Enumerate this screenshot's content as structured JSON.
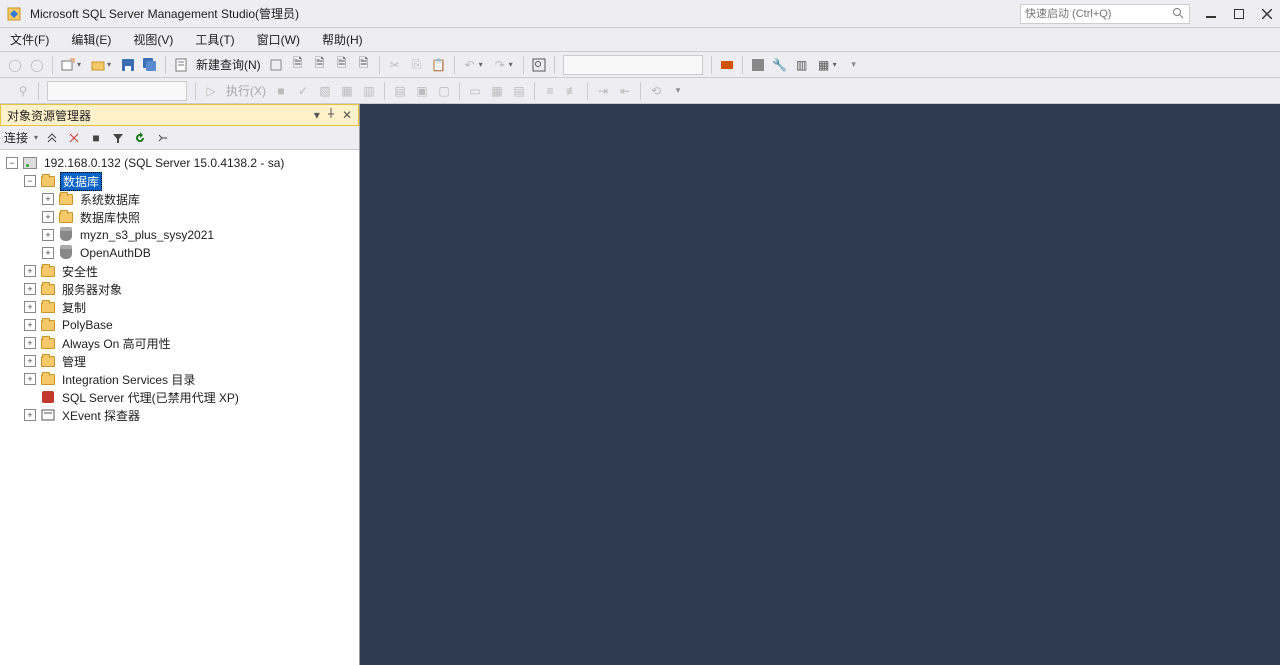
{
  "title": "Microsoft SQL Server Management Studio(管理员)",
  "quick_launch_placeholder": "快速启动 (Ctrl+Q)",
  "menus": {
    "file": "文件(F)",
    "edit": "编辑(E)",
    "view": "视图(V)",
    "tools": "工具(T)",
    "window": "窗口(W)",
    "help": "帮助(H)"
  },
  "toolbar1": {
    "new_query": "新建查询(N)"
  },
  "toolbar2": {
    "execute": "执行(X)"
  },
  "panel": {
    "title": "对象资源管理器",
    "toolbar": {
      "connect": "连接"
    }
  },
  "tree": {
    "server": "192.168.0.132 (SQL Server 15.0.4138.2 - sa)",
    "databases": "数据库",
    "sys_db": "系统数据库",
    "db_snap": "数据库快照",
    "db1": "myzn_s3_plus_sysy2021",
    "db2": "OpenAuthDB",
    "security": "安全性",
    "server_obj": "服务器对象",
    "replication": "复制",
    "polybase": "PolyBase",
    "alwayson": "Always On 高可用性",
    "management": "管理",
    "integration": "Integration Services 目录",
    "agent": "SQL Server 代理(已禁用代理 XP)",
    "xevent": "XEvent 探查器"
  }
}
